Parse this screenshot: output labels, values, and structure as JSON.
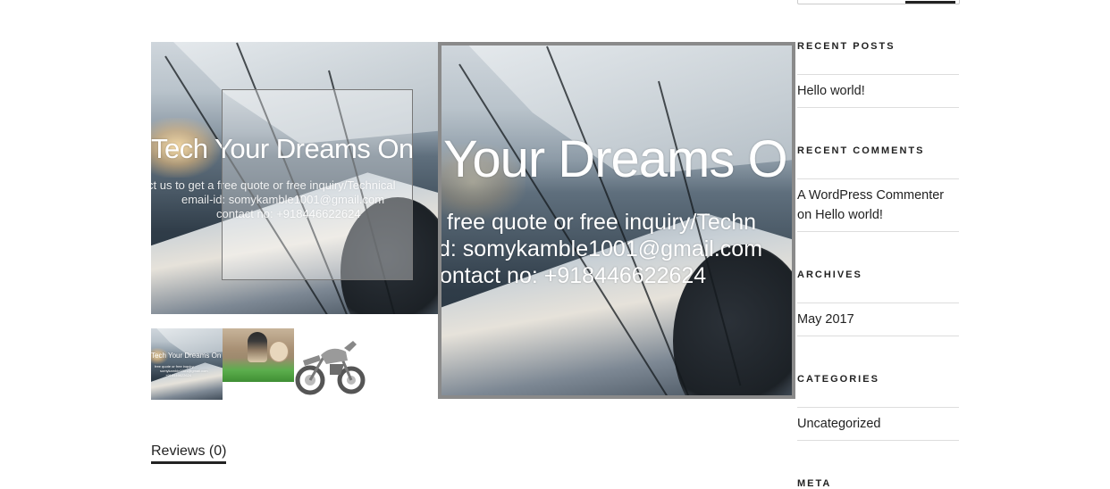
{
  "product_image": {
    "overlay_heading": "Tech Your Dreams On",
    "overlay_lines": [
      "ct us to get a free quote or free inquiry/Technical",
      "email-id: somykamble1001@gmail.com",
      "contact no: +918446622624"
    ]
  },
  "zoom_window": {
    "overlay_heading": "Your Dreams O",
    "overlay_lines": [
      "free quote or free inquiry/Techn",
      "d: somykamble1001@gmail.com",
      "ontact no: +918446622624"
    ]
  },
  "thumbnails": [
    {
      "heading": "Tech Your Dreams On",
      "lines": [
        "free quote or free inquiry",
        "somykamble1001@gmail.com",
        "+918446622624"
      ]
    },
    {
      "label": "person-photo"
    },
    {
      "label": "motorcycle-photo"
    }
  ],
  "tabs": {
    "reviews": "Reviews (0)"
  },
  "sidebar": {
    "recent_posts": {
      "title": "RECENT POSTS",
      "items": [
        "Hello world!"
      ]
    },
    "recent_comments": {
      "title": "RECENT COMMENTS",
      "author": "A WordPress Commenter",
      "on_text": "on",
      "post": "Hello world!"
    },
    "archives": {
      "title": "ARCHIVES",
      "items": [
        "May 2017"
      ]
    },
    "categories": {
      "title": "CATEGORIES",
      "items": [
        "Uncategorized"
      ]
    },
    "meta": {
      "title": "META"
    }
  },
  "colors": {
    "text": "#222222",
    "rule": "#dddddd",
    "zoom_border": "#8a8a8a"
  }
}
